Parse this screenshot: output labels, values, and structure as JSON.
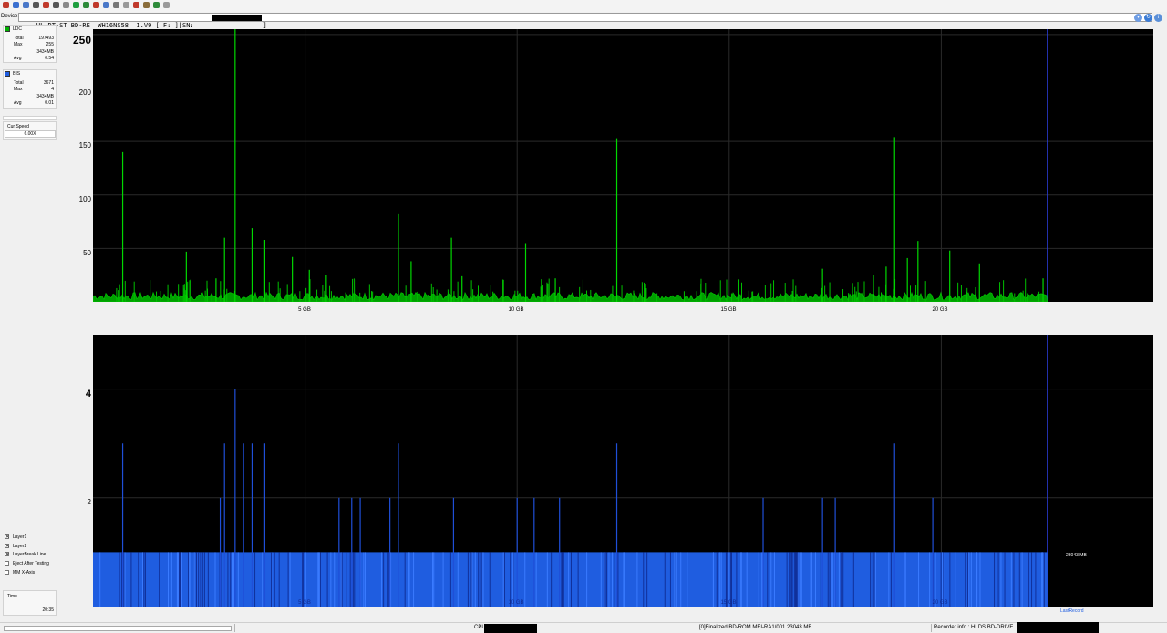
{
  "toolbar": {
    "icons": [
      "exit-icon",
      "save-icon",
      "copy-icon",
      "drive-icon",
      "disc-icon",
      "disc-icon",
      "eject-icon",
      "start-icon",
      "quality-icon",
      "stop-icon",
      "info-icon",
      "settings-icon",
      "erase-icon",
      "print-icon",
      "media-icon",
      "tools-icon",
      "help-icon"
    ]
  },
  "device": {
    "label": "Device:",
    "value": "HL-DT-ST BD-RE  WH16NS58  1.V9 [ F: ][SN:                  ]"
  },
  "sidebar": {
    "ldc": {
      "name": "LDC",
      "color": "#00b000",
      "stats": [
        {
          "label": "Total",
          "value": "197493"
        },
        {
          "label": "Max",
          "value": "255"
        },
        {
          "label": "",
          "value": "3434MB"
        },
        {
          "label": "Avg",
          "value": "0.54"
        }
      ]
    },
    "bis": {
      "name": "BIS",
      "color": "#1f5de0",
      "stats": [
        {
          "label": "Total",
          "value": "3671"
        },
        {
          "label": "Max",
          "value": "4"
        },
        {
          "label": "",
          "value": "3434MB"
        },
        {
          "label": "Avg",
          "value": "0.01"
        }
      ]
    },
    "speed": {
      "label": "Cur Speed",
      "value": "6.00X"
    },
    "options": [
      {
        "label": "Layer1",
        "checked": true
      },
      {
        "label": "Layer2",
        "checked": true
      },
      {
        "label": "LayerBreak Line",
        "checked": true
      },
      {
        "label": "Eject After Testing",
        "checked": false
      },
      {
        "label": "MM X-Axis",
        "checked": false
      }
    ],
    "time": {
      "label": "Time",
      "value": "20:35"
    }
  },
  "chart_data": [
    {
      "type": "bar",
      "series": [
        {
          "name": "LDC",
          "color": "#00d000"
        }
      ],
      "ylim": [
        0,
        255
      ],
      "yticks": [
        "250",
        "200",
        "150",
        "100",
        "50"
      ],
      "xlim": [
        0,
        25
      ],
      "xticks": [
        "5 GB",
        "10 GB",
        "15 GB",
        "20 GB"
      ],
      "x_data_end_gb": 22.5,
      "layer_break_gb": 22.5,
      "spikes": [
        {
          "x": 0.7,
          "y": 140
        },
        {
          "x": 2.2,
          "y": 47
        },
        {
          "x": 2.9,
          "y": 22
        },
        {
          "x": 3.1,
          "y": 60
        },
        {
          "x": 3.35,
          "y": 255
        },
        {
          "x": 3.75,
          "y": 69
        },
        {
          "x": 4.05,
          "y": 58
        },
        {
          "x": 4.7,
          "y": 42
        },
        {
          "x": 5.1,
          "y": 30
        },
        {
          "x": 5.5,
          "y": 25
        },
        {
          "x": 7.2,
          "y": 82
        },
        {
          "x": 7.5,
          "y": 38
        },
        {
          "x": 8.45,
          "y": 60
        },
        {
          "x": 8.7,
          "y": 24
        },
        {
          "x": 10.2,
          "y": 55
        },
        {
          "x": 10.9,
          "y": 22
        },
        {
          "x": 12.35,
          "y": 153
        },
        {
          "x": 13.0,
          "y": 18
        },
        {
          "x": 17.2,
          "y": 31
        },
        {
          "x": 18.4,
          "y": 25
        },
        {
          "x": 18.7,
          "y": 33
        },
        {
          "x": 18.9,
          "y": 154
        },
        {
          "x": 19.2,
          "y": 41
        },
        {
          "x": 19.45,
          "y": 57
        },
        {
          "x": 20.2,
          "y": 48
        },
        {
          "x": 20.9,
          "y": 36
        },
        {
          "x": 22.4,
          "y": 22
        }
      ],
      "baseline": 6
    },
    {
      "type": "bar",
      "series": [
        {
          "name": "BIS",
          "color": "#1f5de0"
        }
      ],
      "ylim": [
        0,
        5
      ],
      "yticks": [
        "4",
        "2"
      ],
      "xlim": [
        0,
        25
      ],
      "xticks": [
        "5 GB",
        "10 GB",
        "15 GB",
        "20 GB"
      ],
      "layer_break_gb": 22.5,
      "fill_level": 1,
      "spikes": [
        {
          "x": 0.7,
          "y": 3
        },
        {
          "x": 3.35,
          "y": 4
        },
        {
          "x": 3.0,
          "y": 2
        },
        {
          "x": 3.1,
          "y": 3
        },
        {
          "x": 3.55,
          "y": 3
        },
        {
          "x": 3.75,
          "y": 3
        },
        {
          "x": 4.05,
          "y": 3
        },
        {
          "x": 7.2,
          "y": 3
        },
        {
          "x": 12.35,
          "y": 3
        },
        {
          "x": 18.9,
          "y": 3
        },
        {
          "x": 5.8,
          "y": 2
        },
        {
          "x": 6.1,
          "y": 2
        },
        {
          "x": 6.3,
          "y": 2
        },
        {
          "x": 7.0,
          "y": 2
        },
        {
          "x": 8.5,
          "y": 2
        },
        {
          "x": 10.0,
          "y": 2
        },
        {
          "x": 10.4,
          "y": 2
        },
        {
          "x": 11.0,
          "y": 2
        },
        {
          "x": 15.8,
          "y": 2
        },
        {
          "x": 17.2,
          "y": 2
        },
        {
          "x": 17.5,
          "y": 2
        },
        {
          "x": 19.8,
          "y": 2
        }
      ],
      "annotation": "23043 MB",
      "annotation2": "LastRecord"
    }
  ],
  "status": {
    "cpu_label": "CPU",
    "disc_info": "[0]Finalized  BD-ROM  MEI-RA1/001  23043 MB",
    "recorder_info": "Recorder info : HLDS BD-DRIVE"
  }
}
